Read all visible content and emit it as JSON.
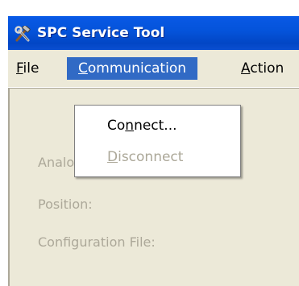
{
  "window": {
    "title": "SPC Service Tool",
    "icon": "crossed-tools-icon"
  },
  "menubar": {
    "items": [
      {
        "mnemonic": "F",
        "rest": "ile"
      },
      {
        "mnemonic": "C",
        "rest": "ommunication"
      },
      {
        "mnemonic": "A",
        "rest": "ction"
      }
    ],
    "active_index": 1
  },
  "communication_menu": {
    "items": [
      {
        "before": "Co",
        "mnemonic": "n",
        "after": "nect...",
        "enabled": true
      },
      {
        "before": "",
        "mnemonic": "D",
        "after": "isconnect",
        "enabled": false
      }
    ]
  },
  "form": {
    "analog_position_demand_label": "Analog Position Demand:",
    "position_label": "Position:",
    "configuration_file_label": "Configuration File:"
  },
  "colors": {
    "titlebar": "#0453da",
    "menu_highlight": "#316ac5",
    "window_face": "#ece9d8",
    "disabled_text": "#aca899"
  }
}
